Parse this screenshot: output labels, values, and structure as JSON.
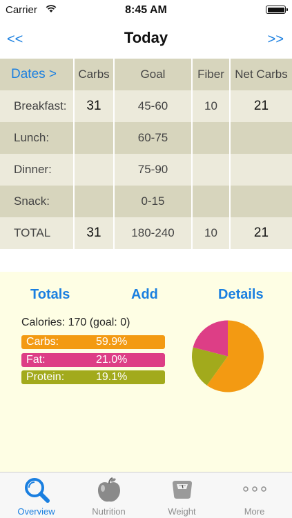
{
  "status_bar": {
    "carrier": "Carrier",
    "time": "8:45 AM"
  },
  "nav": {
    "prev": "<<",
    "title": "Today",
    "next": ">>"
  },
  "table": {
    "headers": [
      "Dates >",
      "Carbs",
      "Goal",
      "Fiber",
      "Net Carbs"
    ],
    "rows": [
      [
        "Breakfast:",
        "31",
        "45-60",
        "10",
        "21"
      ],
      [
        "Lunch:",
        "",
        "60-75",
        "",
        ""
      ],
      [
        "Dinner:",
        "",
        "75-90",
        "",
        ""
      ],
      [
        "Snack:",
        "",
        "0-15",
        "",
        ""
      ],
      [
        "TOTAL",
        "31",
        "180-240",
        "10",
        "21"
      ]
    ]
  },
  "summary": {
    "tabs": {
      "totals": "Totals",
      "add": "Add",
      "details": "Details"
    },
    "calories": "Calories:  170 (goal: 0)",
    "macros": [
      {
        "label": "Carbs:",
        "value": "59.9%",
        "color": "#f39a12"
      },
      {
        "label": "Fat:",
        "value": "21.0%",
        "color": "#dd3e86"
      },
      {
        "label": "Protein:",
        "value": "19.1%",
        "color": "#a2aa1c"
      }
    ]
  },
  "tabbar": {
    "items": [
      {
        "label": "Overview",
        "icon": "magnifier-icon"
      },
      {
        "label": "Nutrition",
        "icon": "apple-icon"
      },
      {
        "label": "Weight",
        "icon": "scale-icon"
      },
      {
        "label": "More",
        "icon": "more-dots-icon"
      }
    ],
    "active_color": "#1a7fe0"
  }
}
